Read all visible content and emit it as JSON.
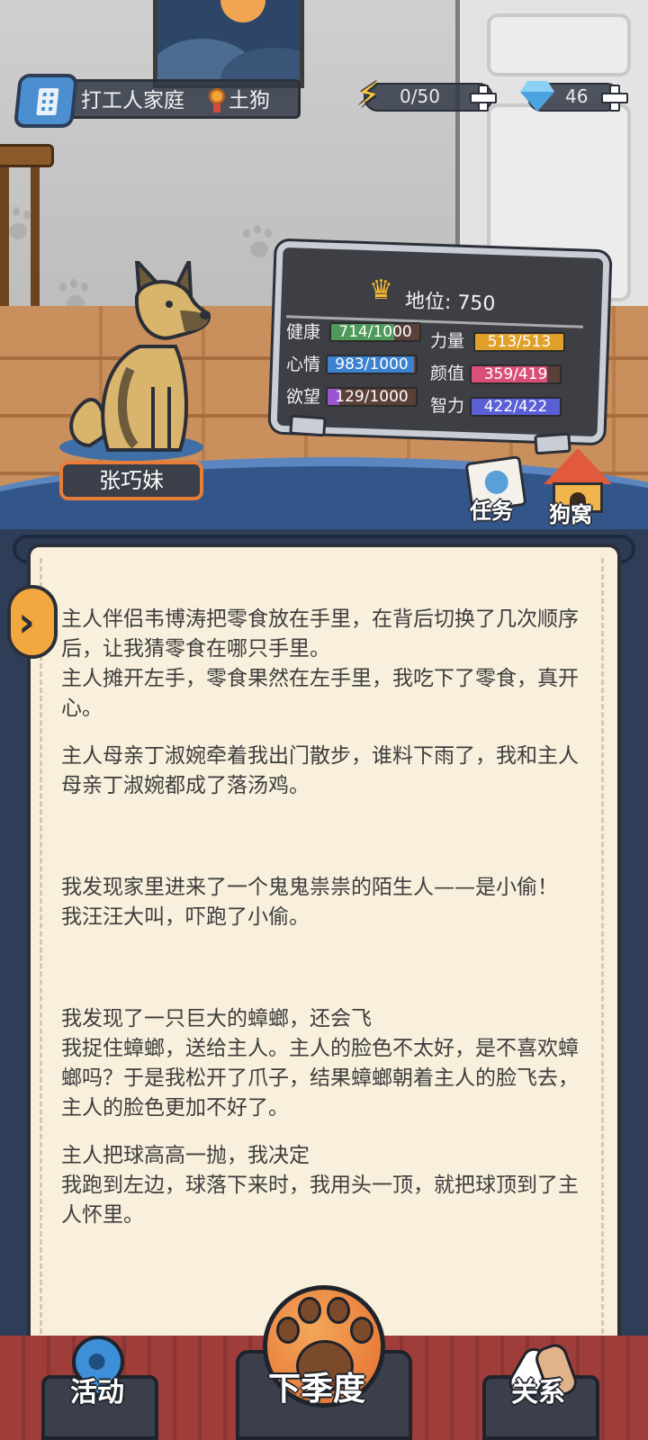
{
  "header": {
    "family_name": "打工人家庭",
    "rank_name": "土狗",
    "energy": "0/50",
    "gems": "46"
  },
  "pet": {
    "name": "张巧妹"
  },
  "stats_board": {
    "status_label": "地位: 750",
    "stats": [
      {
        "label": "健康",
        "value": "714/1000",
        "fraction": 0.714,
        "color": "#4e9a5a"
      },
      {
        "label": "力量",
        "value": "513/513",
        "fraction": 1.0,
        "color": "#e0a02a"
      },
      {
        "label": "心情",
        "value": "983/1000",
        "fraction": 0.983,
        "color": "#3b82d0"
      },
      {
        "label": "颜值",
        "value": "359/419",
        "fraction": 0.857,
        "color": "#d8507a"
      },
      {
        "label": "欲望",
        "value": "129/1000",
        "fraction": 0.129,
        "color": "#9a55d2"
      },
      {
        "label": "智力",
        "value": "422/422",
        "fraction": 1.0,
        "color": "#5b5fd6"
      }
    ]
  },
  "shortcuts": {
    "tasks": "任务",
    "kennel": "狗窝"
  },
  "story": {
    "entries": [
      "主人伴侣韦博涛把零食放在手里，在背后切换了几次顺序后，让我猜零食在哪只手里。\n主人摊开左手，零食果然在左手里，我吃下了零食，真开心。",
      "主人母亲丁淑婉牵着我出门散步，谁料下雨了，我和主人母亲丁淑婉都成了落汤鸡。",
      "我发现家里进来了一个鬼鬼祟祟的陌生人——是小偷！\n我汪汪大叫，吓跑了小偷。",
      "我发现了一只巨大的蟑螂，还会飞\n我捉住蟑螂，送给主人。主人的脸色不太好，是不喜欢蟑螂吗？于是我松开了爪子，结果蟑螂朝着主人的脸飞去，主人的脸色更加不好了。",
      "主人把球高高一抛，我决定\n我跑到左边，球落下来时，我用头一顶，就把球顶到了主人怀里。"
    ]
  },
  "bottom_nav": {
    "activity": "活动",
    "next_season": "下季度",
    "relations": "关系"
  }
}
